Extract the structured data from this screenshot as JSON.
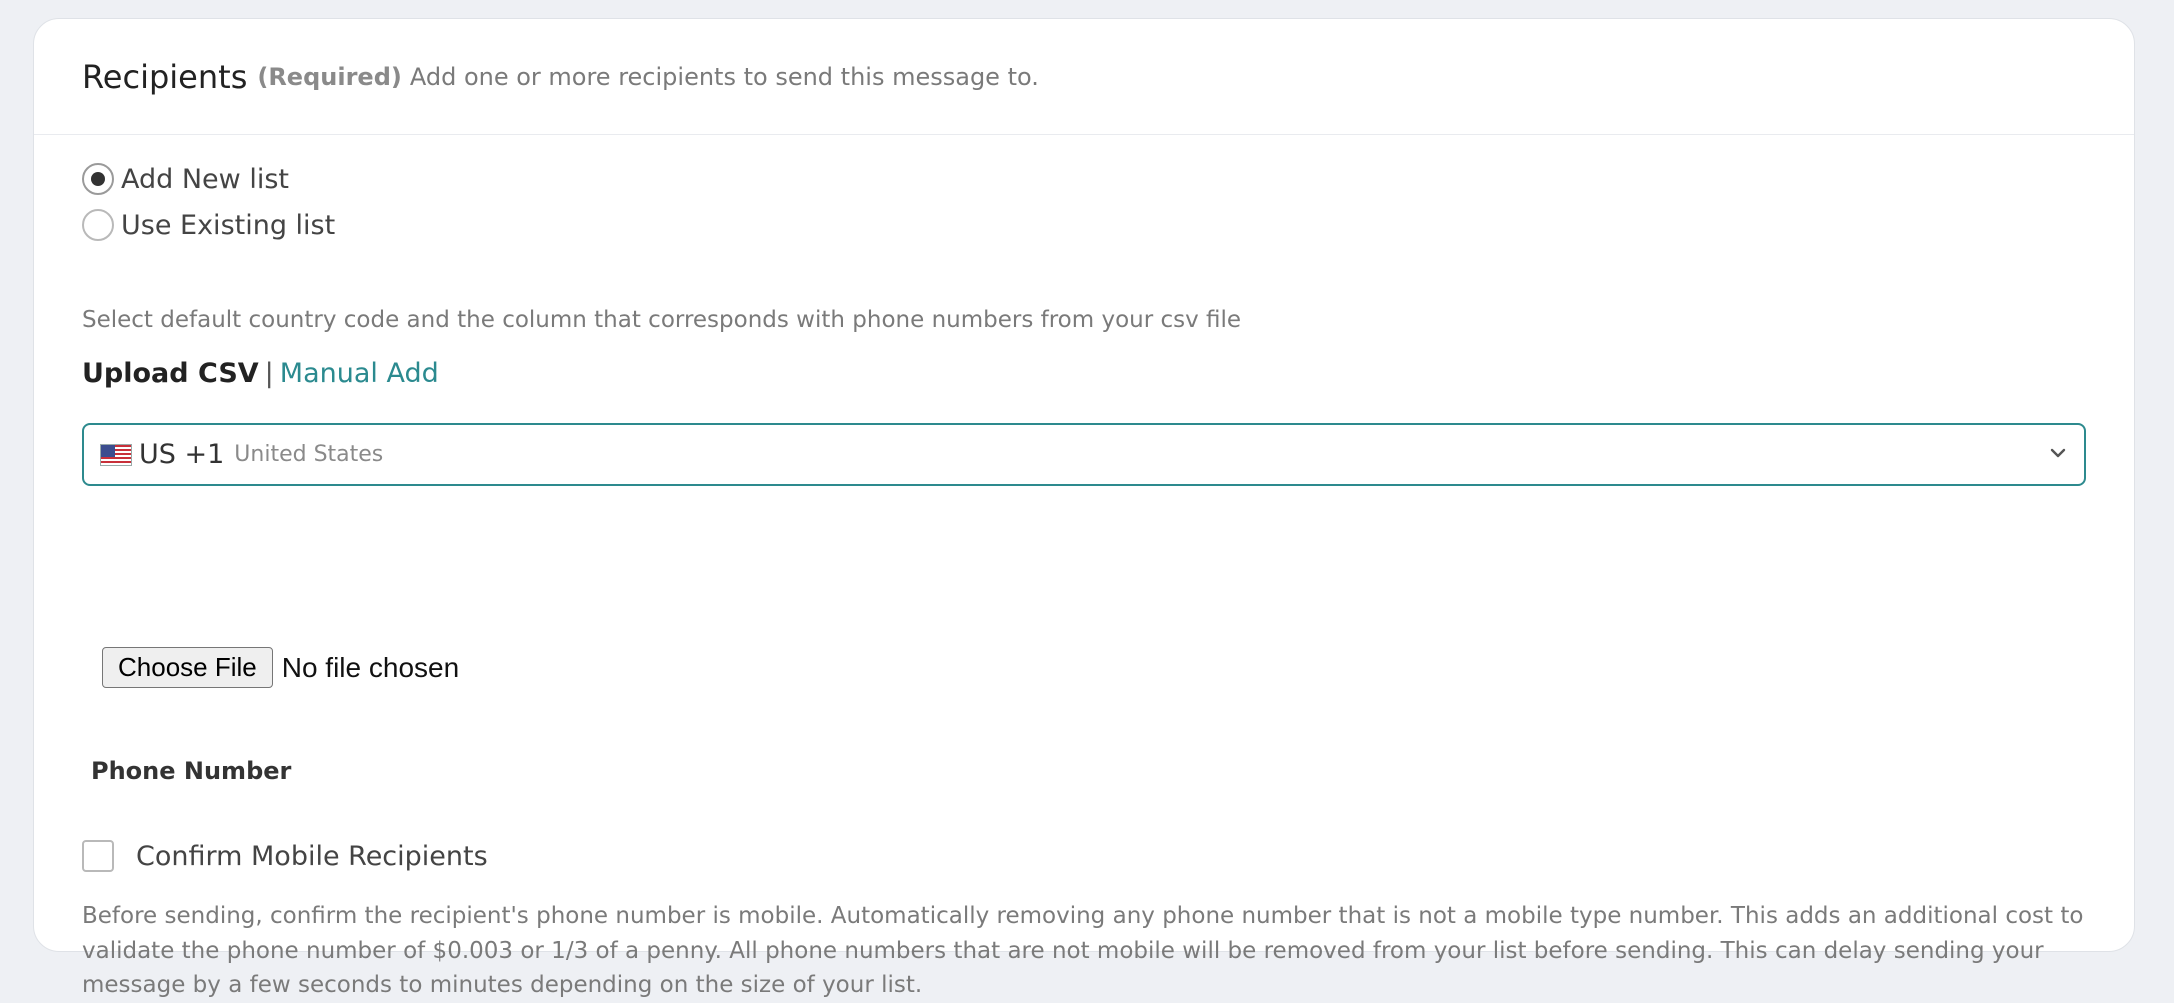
{
  "header": {
    "title": "Recipients",
    "required": "(Required)",
    "subtitle": "Add one or more recipients to send this message to."
  },
  "list_source": {
    "options": [
      {
        "label": "Add New list",
        "checked": true
      },
      {
        "label": "Use Existing list",
        "checked": false
      }
    ]
  },
  "hint": "Select default country code and the column that corresponds with phone numbers from your csv file",
  "mode": {
    "upload_label": "Upload CSV",
    "separator": "|",
    "manual_label": "Manual Add"
  },
  "country": {
    "code": "US +1",
    "name": "United States",
    "flag_icon": "us-flag-icon",
    "accent": "#2d8a8e"
  },
  "file": {
    "button_label": "Choose File",
    "status": "No file chosen"
  },
  "column_label": "Phone Number",
  "confirm": {
    "label": "Confirm Mobile Recipients",
    "checked": false,
    "help": "Before sending, confirm the recipient's phone number is mobile. Automatically removing any phone number that is not a mobile type number. This adds an additional cost to validate the phone number of $0.003 or 1/3 of a penny. All phone numbers that are not mobile will be removed from your list before sending. This can delay sending your message by a few seconds to minutes depending on the size of your list."
  }
}
